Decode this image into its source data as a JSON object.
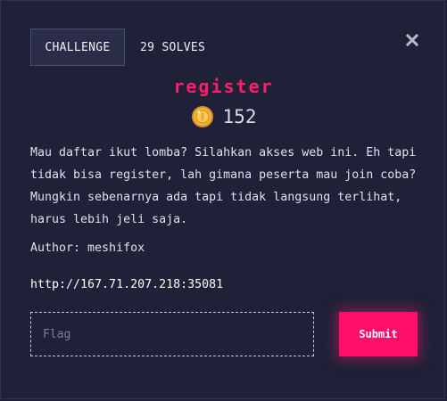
{
  "tabs": {
    "challenge_label": "CHALLENGE",
    "solves_label": "29 SOLVES"
  },
  "challenge": {
    "name": "register",
    "value": "152",
    "description": "Mau daftar ikut lomba? Silahkan akses web ini. Eh tapi tidak bisa register, lah gimana peserta mau join coba? Mungkin sebenarnya ada tapi tidak langsung terlihat, harus lebih jeli saja.",
    "author": "Author: meshifox",
    "url": "http://167.71.207.218:35081"
  },
  "form": {
    "flag_placeholder": "Flag",
    "flag_value": "",
    "submit_label": "Submit"
  },
  "icons": {
    "close": "close-icon",
    "coin": "coin-icon"
  },
  "colors": {
    "background": "#1f2138",
    "accent": "#ff1f6a",
    "submit": "#ff0f6a",
    "coin": "#f2b632"
  }
}
